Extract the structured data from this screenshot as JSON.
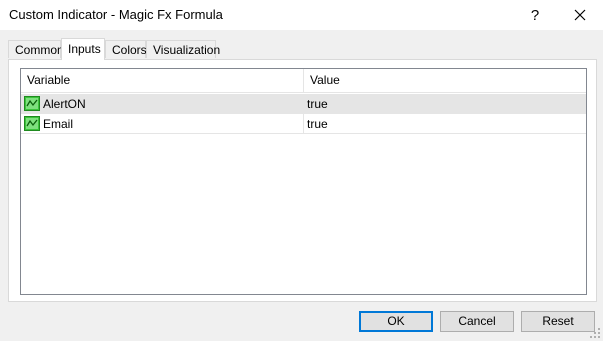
{
  "window": {
    "title": "Custom Indicator - Magic Fx Formula",
    "help_glyph": "?",
    "close_icon": "close-icon"
  },
  "tabs": [
    {
      "label": "Common",
      "active": false
    },
    {
      "label": "Inputs",
      "active": true
    },
    {
      "label": "Colors",
      "active": false
    },
    {
      "label": "Visualization",
      "active": false
    }
  ],
  "grid": {
    "columns": [
      "Variable",
      "Value"
    ],
    "rows": [
      {
        "variable": "AlertON",
        "value": "true",
        "icon": "parameter-icon",
        "selected": true
      },
      {
        "variable": "Email",
        "value": "true",
        "icon": "parameter-icon",
        "selected": false
      }
    ]
  },
  "buttons": {
    "ok": "OK",
    "cancel": "Cancel",
    "reset": "Reset"
  },
  "colors": {
    "focus_border": "#0078d7",
    "icon_green": "#2fb02f",
    "selected_row": "#e5e5e5"
  }
}
